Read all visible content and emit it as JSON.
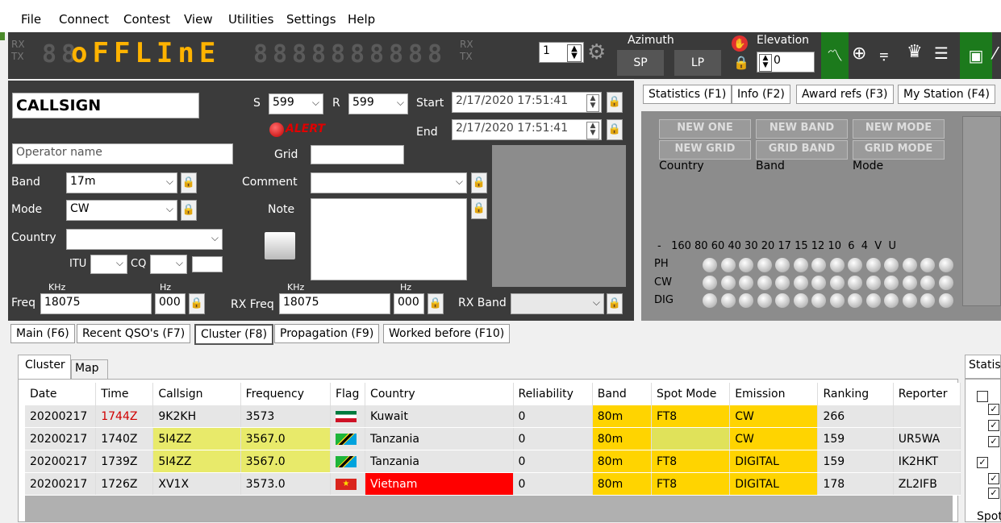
{
  "menu": [
    "File",
    "Connect",
    "Contest",
    "View",
    "Utilities",
    "Settings",
    "Help"
  ],
  "display": {
    "rx": "RX",
    "tx": "TX",
    "status": "oFFLInE",
    "rx2": "RX",
    "tx2": "TX",
    "lcd_placeholder": "8"
  },
  "controls": {
    "vfo_select": "1",
    "azimuth_label": "Azimuth",
    "sp": "SP",
    "lp": "LP",
    "elevation_label": "Elevation",
    "elevation_value": "0"
  },
  "qso": {
    "callsign": "CALLSIGN",
    "s_label": "S",
    "s_value": "599",
    "r_label": "R",
    "r_value": "599",
    "start_label": "Start",
    "start_value": "2/17/2020 17:51:41",
    "end_label": "End",
    "end_value": "2/17/2020 17:51:41",
    "alert": "ALERT",
    "operator_placeholder": "Operator name",
    "grid_label": "Grid",
    "band_label": "Band",
    "band_value": "17m",
    "comment_label": "Comment",
    "mode_label": "Mode",
    "mode_value": "CW",
    "note_label": "Note",
    "country_label": "Country",
    "itu_label": "ITU",
    "cq_label": "CQ",
    "khz": "KHz",
    "hz": "Hz",
    "freq_label": "Freq",
    "freq_value": "18075",
    "freq_hz": "000",
    "rxfreq_label": "RX Freq",
    "rxfreq_value": "18075",
    "rxfreq_hz": "000",
    "rxband_label": "RX Band"
  },
  "right_tabs": [
    "Statistics (F1)",
    "Info (F2)",
    "Award refs (F3)",
    "My Station (F4)"
  ],
  "stats": {
    "buttons": [
      "NEW ONE",
      "NEW BAND",
      "NEW MODE",
      "NEW GRID",
      "GRID BAND",
      "GRID MODE"
    ],
    "labels": [
      "Country",
      "Band",
      "Mode"
    ],
    "band_header": "-   160 80 60 40 30 20 17 15 12 10  6  4  V  U",
    "modes": [
      "PH",
      "CW",
      "DIG"
    ]
  },
  "bottom_tabs": [
    "Main (F6)",
    "Recent QSO's (F7)",
    "Cluster (F8)",
    "Propagation (F9)",
    "Worked before (F10)"
  ],
  "cluster_tabs": [
    "Cluster",
    "Map"
  ],
  "side_label": "Statis",
  "side_bottom": "Spot",
  "table": {
    "headers": [
      "Date",
      "Time",
      "Callsign",
      "Frequency",
      "Flag",
      "Country",
      "Reliability",
      "Band",
      "Spot Mode",
      "Emission",
      "Ranking",
      "Reporter"
    ],
    "rows": [
      [
        "20200217",
        "1744Z",
        "9K2KH",
        "3573",
        "kw",
        "Kuwait",
        "0",
        "80m",
        "FT8",
        "CW",
        "266",
        ""
      ],
      [
        "20200217",
        "1740Z",
        "5I4ZZ",
        "3567.0",
        "tz",
        "Tanzania",
        "0",
        "80m",
        "",
        "CW",
        "159",
        "UR5WA"
      ],
      [
        "20200217",
        "1739Z",
        "5I4ZZ",
        "3567.0",
        "tz",
        "Tanzania",
        "0",
        "80m",
        "FT8",
        "DIGITAL",
        "159",
        "IK2HKT"
      ],
      [
        "20200217",
        "1726Z",
        "XV1X",
        "3573.0",
        "vn",
        "Vietnam",
        "0",
        "80m",
        "FT8",
        "DIGITAL",
        "178",
        "ZL2IFB"
      ]
    ]
  }
}
